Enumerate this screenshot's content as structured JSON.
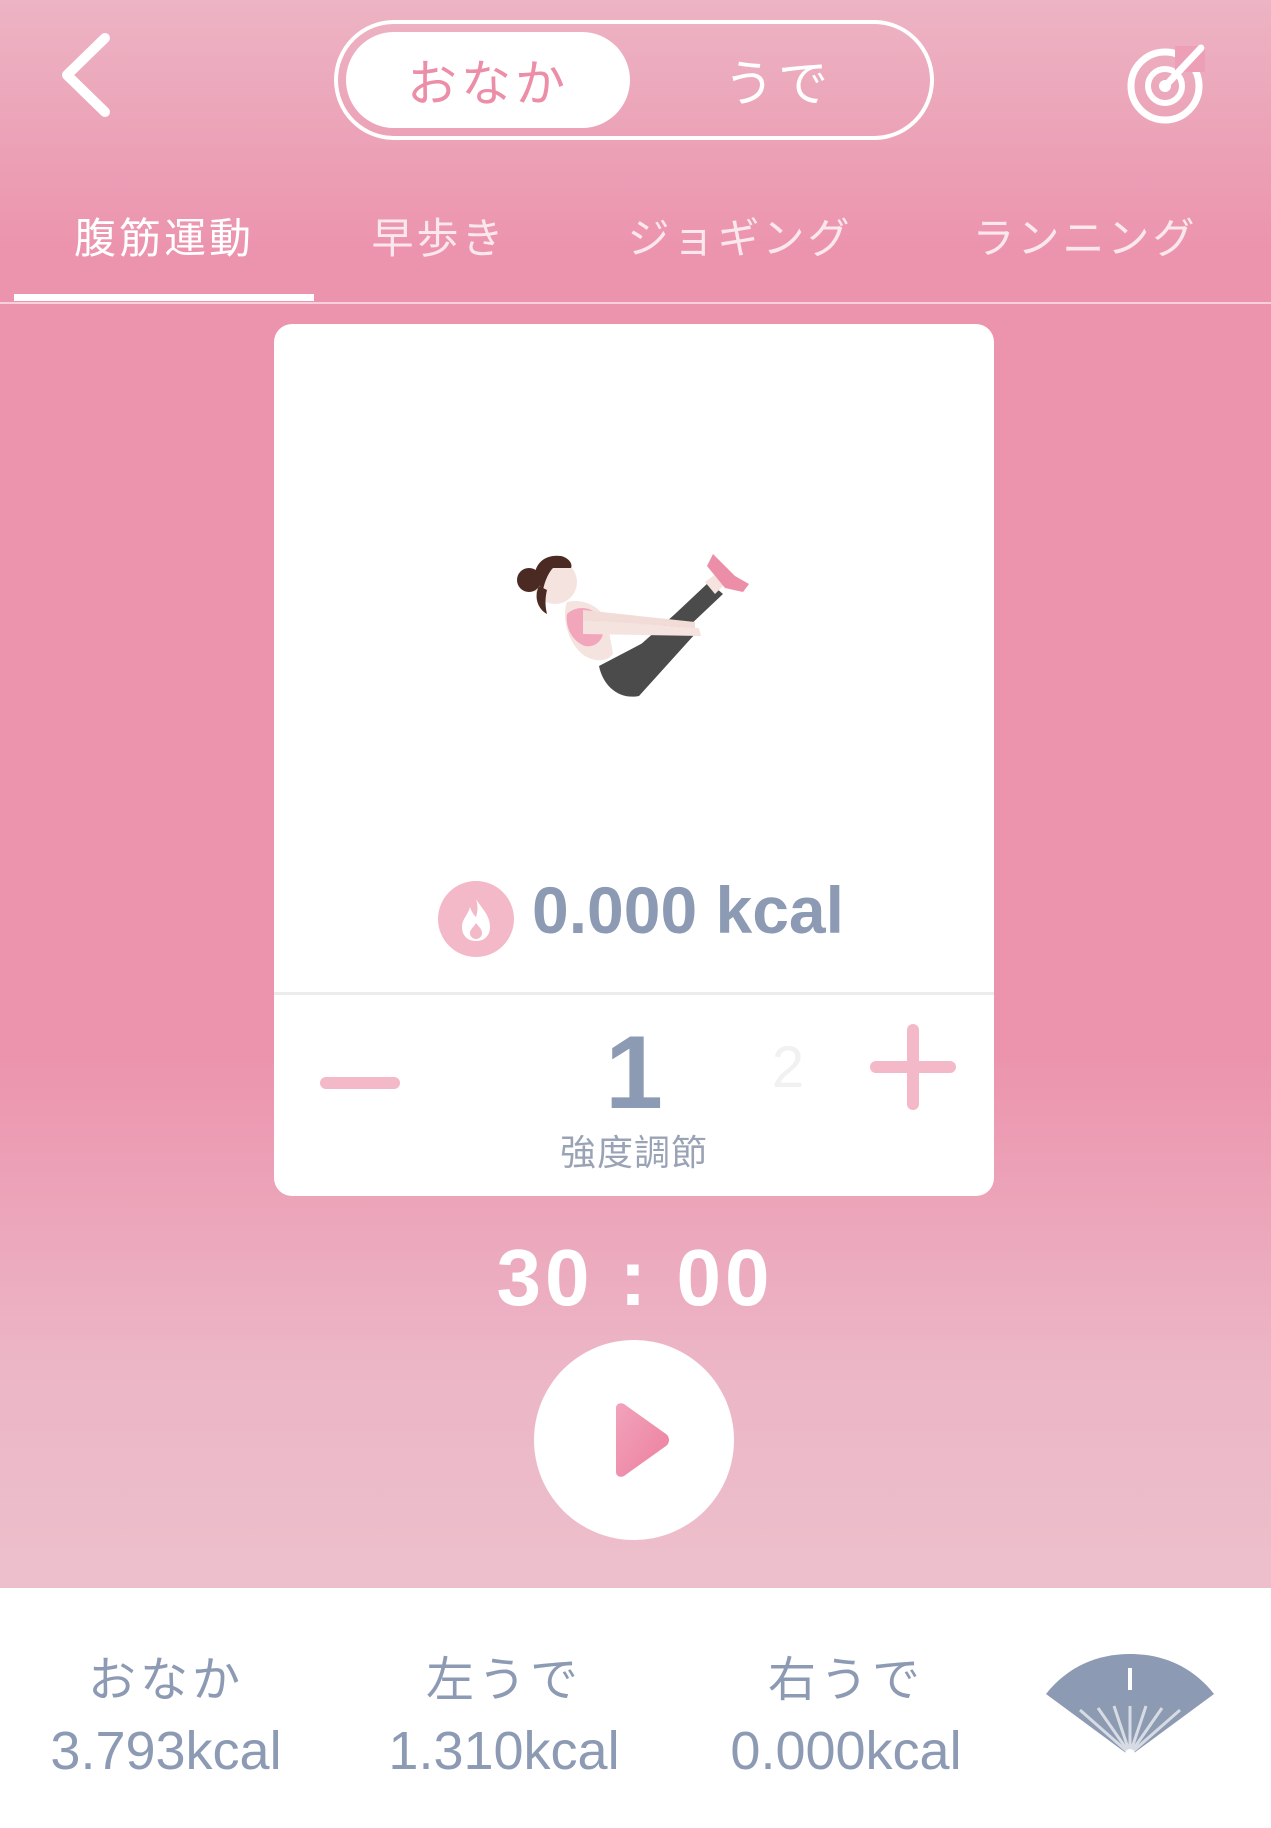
{
  "header": {
    "segment": {
      "active_label": "おなか",
      "inactive_label": "うで"
    }
  },
  "tabs": [
    {
      "label": "腹筋運動",
      "active": true
    },
    {
      "label": "早歩き",
      "active": false
    },
    {
      "label": "ジョギング",
      "active": false
    },
    {
      "label": "ランニング",
      "active": false
    }
  ],
  "card": {
    "kcal": "0.000 kcal",
    "intensity": {
      "current": "1",
      "next": "2",
      "label": "強度調節"
    }
  },
  "timer": "30 : 00",
  "summary": [
    {
      "label": "おなか",
      "value": "3.793kcal"
    },
    {
      "label": "左うで",
      "value": "1.310kcal"
    },
    {
      "label": "右うで",
      "value": "0.000kcal"
    }
  ],
  "colors": {
    "accent_pink": "#ec93ad",
    "text_slate": "#8d9ab3",
    "flame_bg": "#f3b9c8",
    "white": "#ffffff"
  },
  "icons": {
    "back": "chevron-left-icon",
    "settings": "disc-edit-icon",
    "flame": "flame-icon",
    "minus": "minus-icon",
    "plus": "plus-icon",
    "play": "play-icon",
    "fan": "fan-icon"
  }
}
